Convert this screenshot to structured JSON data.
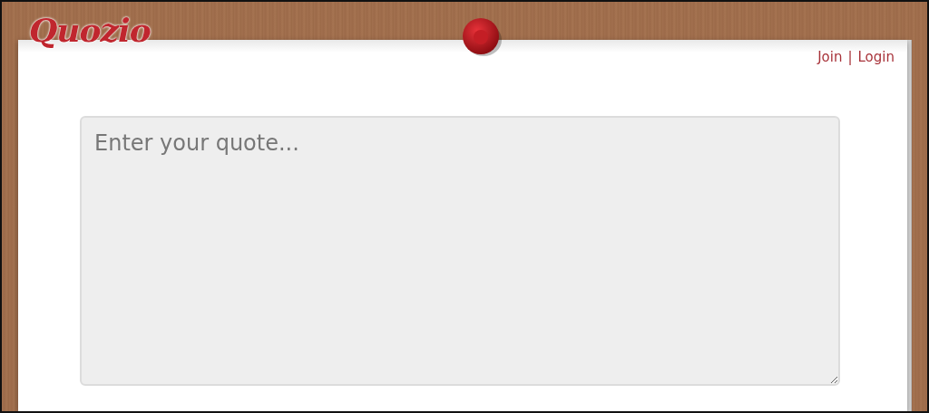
{
  "logo": {
    "text": "Quozio"
  },
  "nav": {
    "links": [
      {
        "label": "Join"
      },
      {
        "label": "Login"
      }
    ],
    "separator": "|"
  },
  "quote_field": {
    "placeholder": "Enter your quote..."
  }
}
